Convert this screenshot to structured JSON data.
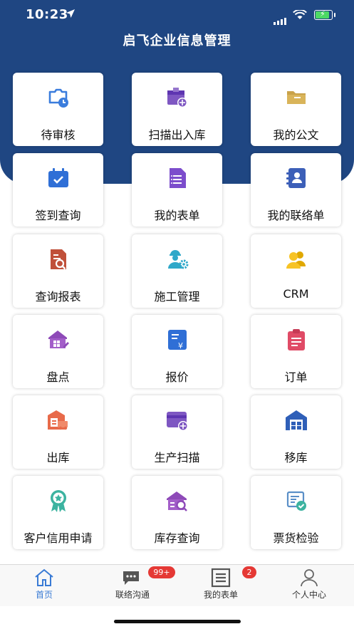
{
  "status_bar": {
    "time": "10:23"
  },
  "header": {
    "title": "启飞企业信息管理"
  },
  "menu": {
    "items": [
      {
        "label": "待审核",
        "icon": "pending-review-icon"
      },
      {
        "label": "扫描出入库",
        "icon": "scan-inout-icon"
      },
      {
        "label": "我的公文",
        "icon": "folder-icon"
      },
      {
        "label": "签到查询",
        "icon": "calendar-check-icon"
      },
      {
        "label": "我的表单",
        "icon": "form-icon"
      },
      {
        "label": "我的联络单",
        "icon": "contact-book-icon"
      },
      {
        "label": "查询报表",
        "icon": "report-search-icon"
      },
      {
        "label": "施工管理",
        "icon": "worker-gear-icon"
      },
      {
        "label": "CRM",
        "icon": "people-icon"
      },
      {
        "label": "盘点",
        "icon": "house-edit-icon"
      },
      {
        "label": "报价",
        "icon": "yuan-doc-icon"
      },
      {
        "label": "订单",
        "icon": "clipboard-icon"
      },
      {
        "label": "出库",
        "icon": "warehouse-truck-icon"
      },
      {
        "label": "生产扫描",
        "icon": "card-scan-icon"
      },
      {
        "label": "移库",
        "icon": "warehouse-icon"
      },
      {
        "label": "客户信用申请",
        "icon": "award-badge-icon"
      },
      {
        "label": "库存查询",
        "icon": "house-search-icon"
      },
      {
        "label": "票货检验",
        "icon": "invoice-check-icon"
      }
    ]
  },
  "tabbar": {
    "home": "首页",
    "chat": "联络沟通",
    "chat_badge": "99+",
    "forms": "我的表单",
    "forms_badge": "2",
    "profile": "个人中心"
  },
  "colors": {
    "header_bg": "#1f4682",
    "tab_active": "#3a7bd5",
    "badge": "#e53935"
  }
}
